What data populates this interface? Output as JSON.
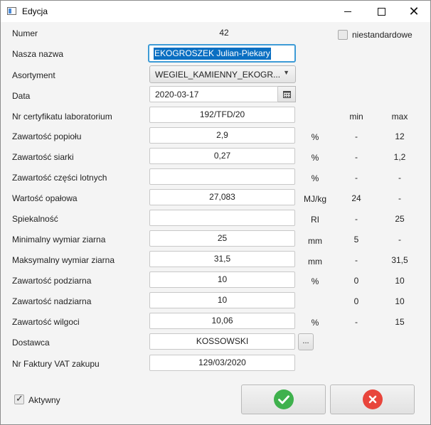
{
  "window": {
    "title": "Edycja",
    "minimize_glyph": "—",
    "maximize_glyph": "☐",
    "close_glyph": "✕"
  },
  "header": {
    "numer_label": "Numer",
    "numer_value": "42",
    "niestandardowe_label": "niestandardowe",
    "niestandardowe_checked": false
  },
  "form": {
    "nasza_nazwa": {
      "label": "Nasza nazwa",
      "value": "EKOGROSZEK Julian-Piekary"
    },
    "asortyment": {
      "label": "Asortyment",
      "value": "WEGIEL_KAMIENNY_EKOGR..."
    },
    "data": {
      "label": "Data",
      "value": "2020-03-17"
    },
    "nr_certyfikatu": {
      "label": "Nr certyfikatu laboratorium",
      "value": "192/TFD/20"
    },
    "dostawca": {
      "label": "Dostawca",
      "value": "KOSSOWSKI",
      "browse_label": "..."
    },
    "nr_faktury": {
      "label": "Nr Faktury VAT zakupu",
      "value": "129/03/2020"
    }
  },
  "columns": {
    "min": "min",
    "max": "max"
  },
  "parameters": [
    {
      "label": "Zawartość popiołu",
      "value": "2,9",
      "unit": "%",
      "min": "-",
      "max": "12"
    },
    {
      "label": "Zawartość siarki",
      "value": "0,27",
      "unit": "%",
      "min": "-",
      "max": "1,2"
    },
    {
      "label": "Zawartość części lotnych",
      "value": "",
      "unit": "%",
      "min": "-",
      "max": "-"
    },
    {
      "label": "Wartość opałowa",
      "value": "27,083",
      "unit": "MJ/kg",
      "min": "24",
      "max": "-"
    },
    {
      "label": "Spiekalność",
      "value": "",
      "unit": "RI",
      "min": "-",
      "max": "25"
    },
    {
      "label": "Minimalny wymiar ziarna",
      "value": "25",
      "unit": "mm",
      "min": "5",
      "max": "-"
    },
    {
      "label": "Maksymalny wymiar ziarna",
      "value": "31,5",
      "unit": "mm",
      "min": "-",
      "max": "31,5"
    },
    {
      "label": "Zawartość podziarna",
      "value": "10",
      "unit": "%",
      "min": "0",
      "max": "10"
    },
    {
      "label": "Zawartość nadziarna",
      "value": "10",
      "unit": "",
      "min": "0",
      "max": "10"
    },
    {
      "label": "Zawartość wilgoci",
      "value": "10,06",
      "unit": "%",
      "min": "-",
      "max": "15"
    }
  ],
  "footer": {
    "aktywny_label": "Aktywny",
    "aktywny_checked": true,
    "ok_icon": "check-icon",
    "cancel_icon": "cancel-icon",
    "ok_color": "#3fb14d",
    "cancel_color": "#e8453c"
  }
}
